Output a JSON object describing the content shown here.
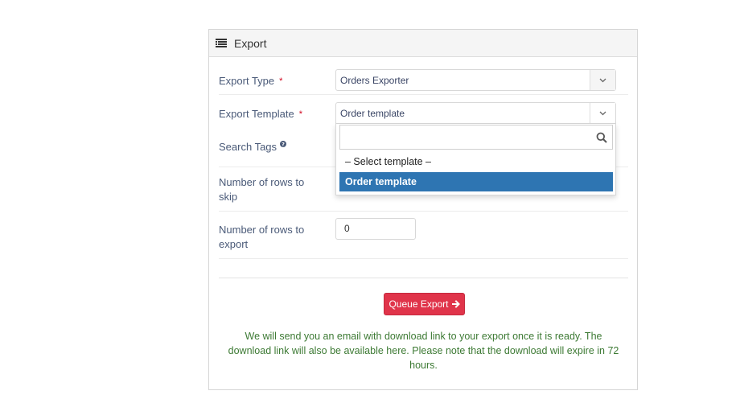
{
  "panel": {
    "title": "Export",
    "title_icon": "list-icon"
  },
  "form": {
    "export_type": {
      "label": "Export Type",
      "required_mark": "*",
      "value": "Orders Exporter"
    },
    "export_template": {
      "label": "Export Template",
      "required_mark": "*",
      "value": "Order template",
      "dropdown": {
        "search_value": "",
        "options": [
          "– Select template –",
          "Order template"
        ],
        "selected_index": 1
      }
    },
    "search_tags": {
      "label": "Search Tags",
      "help_icon": "question-circle-icon"
    },
    "rows_to_skip": {
      "label_line1": "Number of rows to",
      "label_line2": "skip"
    },
    "rows_to_export": {
      "label_line1": "Number of rows to",
      "label_line2": "export",
      "value": "0"
    }
  },
  "actions": {
    "queue_label": "Queue Export",
    "queue_icon": "arrow-right-icon"
  },
  "note": {
    "line1": "We will send you an email with download link to your export once it is ready. The",
    "line2": "download link will also be available here. Please note that the download will expire in 72",
    "line3": "hours."
  },
  "colors": {
    "accent_danger": "#e0344a",
    "selected_option": "#2e75b2",
    "note_text": "#3d7a34",
    "required": "#d0021b"
  }
}
